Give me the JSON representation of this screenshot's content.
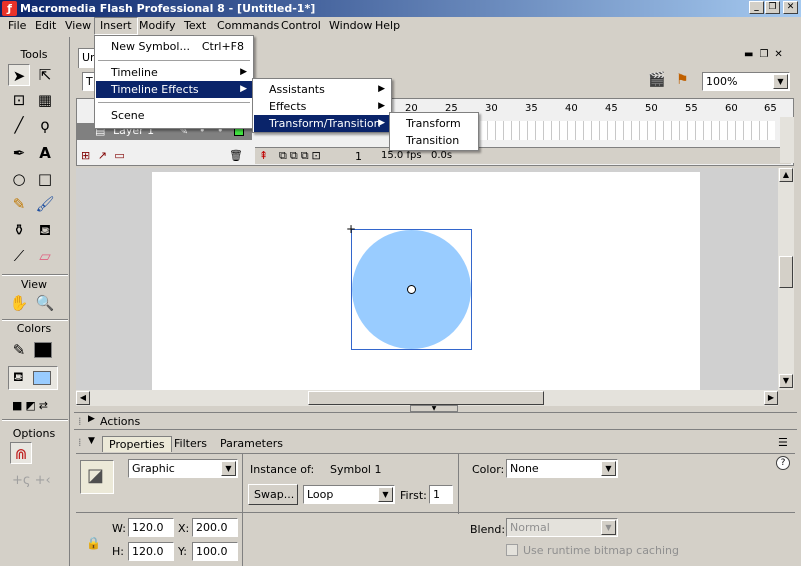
{
  "window": {
    "title": "Macromedia Flash Professional 8 - [Untitled-1*]",
    "min": "_",
    "restore": "❐",
    "close": "✕"
  },
  "menubar": [
    "File",
    "Edit",
    "View",
    "Insert",
    "Modify",
    "Text",
    "Commands",
    "Control",
    "Window",
    "Help"
  ],
  "tools": {
    "title": "Tools",
    "view_title": "View",
    "colors_title": "Colors",
    "options_title": "Options",
    "stroke_color": "#000000",
    "fill_color": "#99ccff"
  },
  "insert_menu": {
    "items": [
      {
        "label": "New Symbol...",
        "shortcut": "Ctrl+F8"
      },
      {
        "label": "Timeline"
      },
      {
        "label": "Timeline Effects"
      },
      {
        "label": "Scene"
      }
    ]
  },
  "timeline_effects_menu": [
    "Assistants",
    "Effects",
    "Transform/Transition"
  ],
  "transform_menu": [
    "Transform",
    "Transition"
  ],
  "document": {
    "tab_label": "Un",
    "scene_label": "T",
    "zoom": "100%"
  },
  "timeline": {
    "layer_name": "Layer 1",
    "frame_numbers": [
      "20",
      "25",
      "30",
      "35",
      "40",
      "45",
      "50",
      "55",
      "60",
      "65"
    ],
    "current_frame": "1",
    "fps": "15.0 fps",
    "elapsed": "0.0s"
  },
  "panels": {
    "actions_label": "Actions"
  },
  "properties": {
    "tabs": [
      "Properties",
      "Filters",
      "Parameters"
    ],
    "symbol_behavior": "Graphic",
    "instance_label": "Instance of:",
    "instance_name": "Symbol 1",
    "swap_label": "Swap...",
    "loop_option": "Loop",
    "first_label": "First:",
    "first_value": "1",
    "color_label": "Color:",
    "color_value": "None",
    "w_label": "W:",
    "w_value": "120.0",
    "h_label": "H:",
    "h_value": "120.0",
    "x_label": "X:",
    "x_value": "200.0",
    "y_label": "Y:",
    "y_value": "100.0",
    "blend_label": "Blend:",
    "blend_value": "Normal",
    "cache_label": "Use runtime bitmap caching",
    "help": "?"
  }
}
